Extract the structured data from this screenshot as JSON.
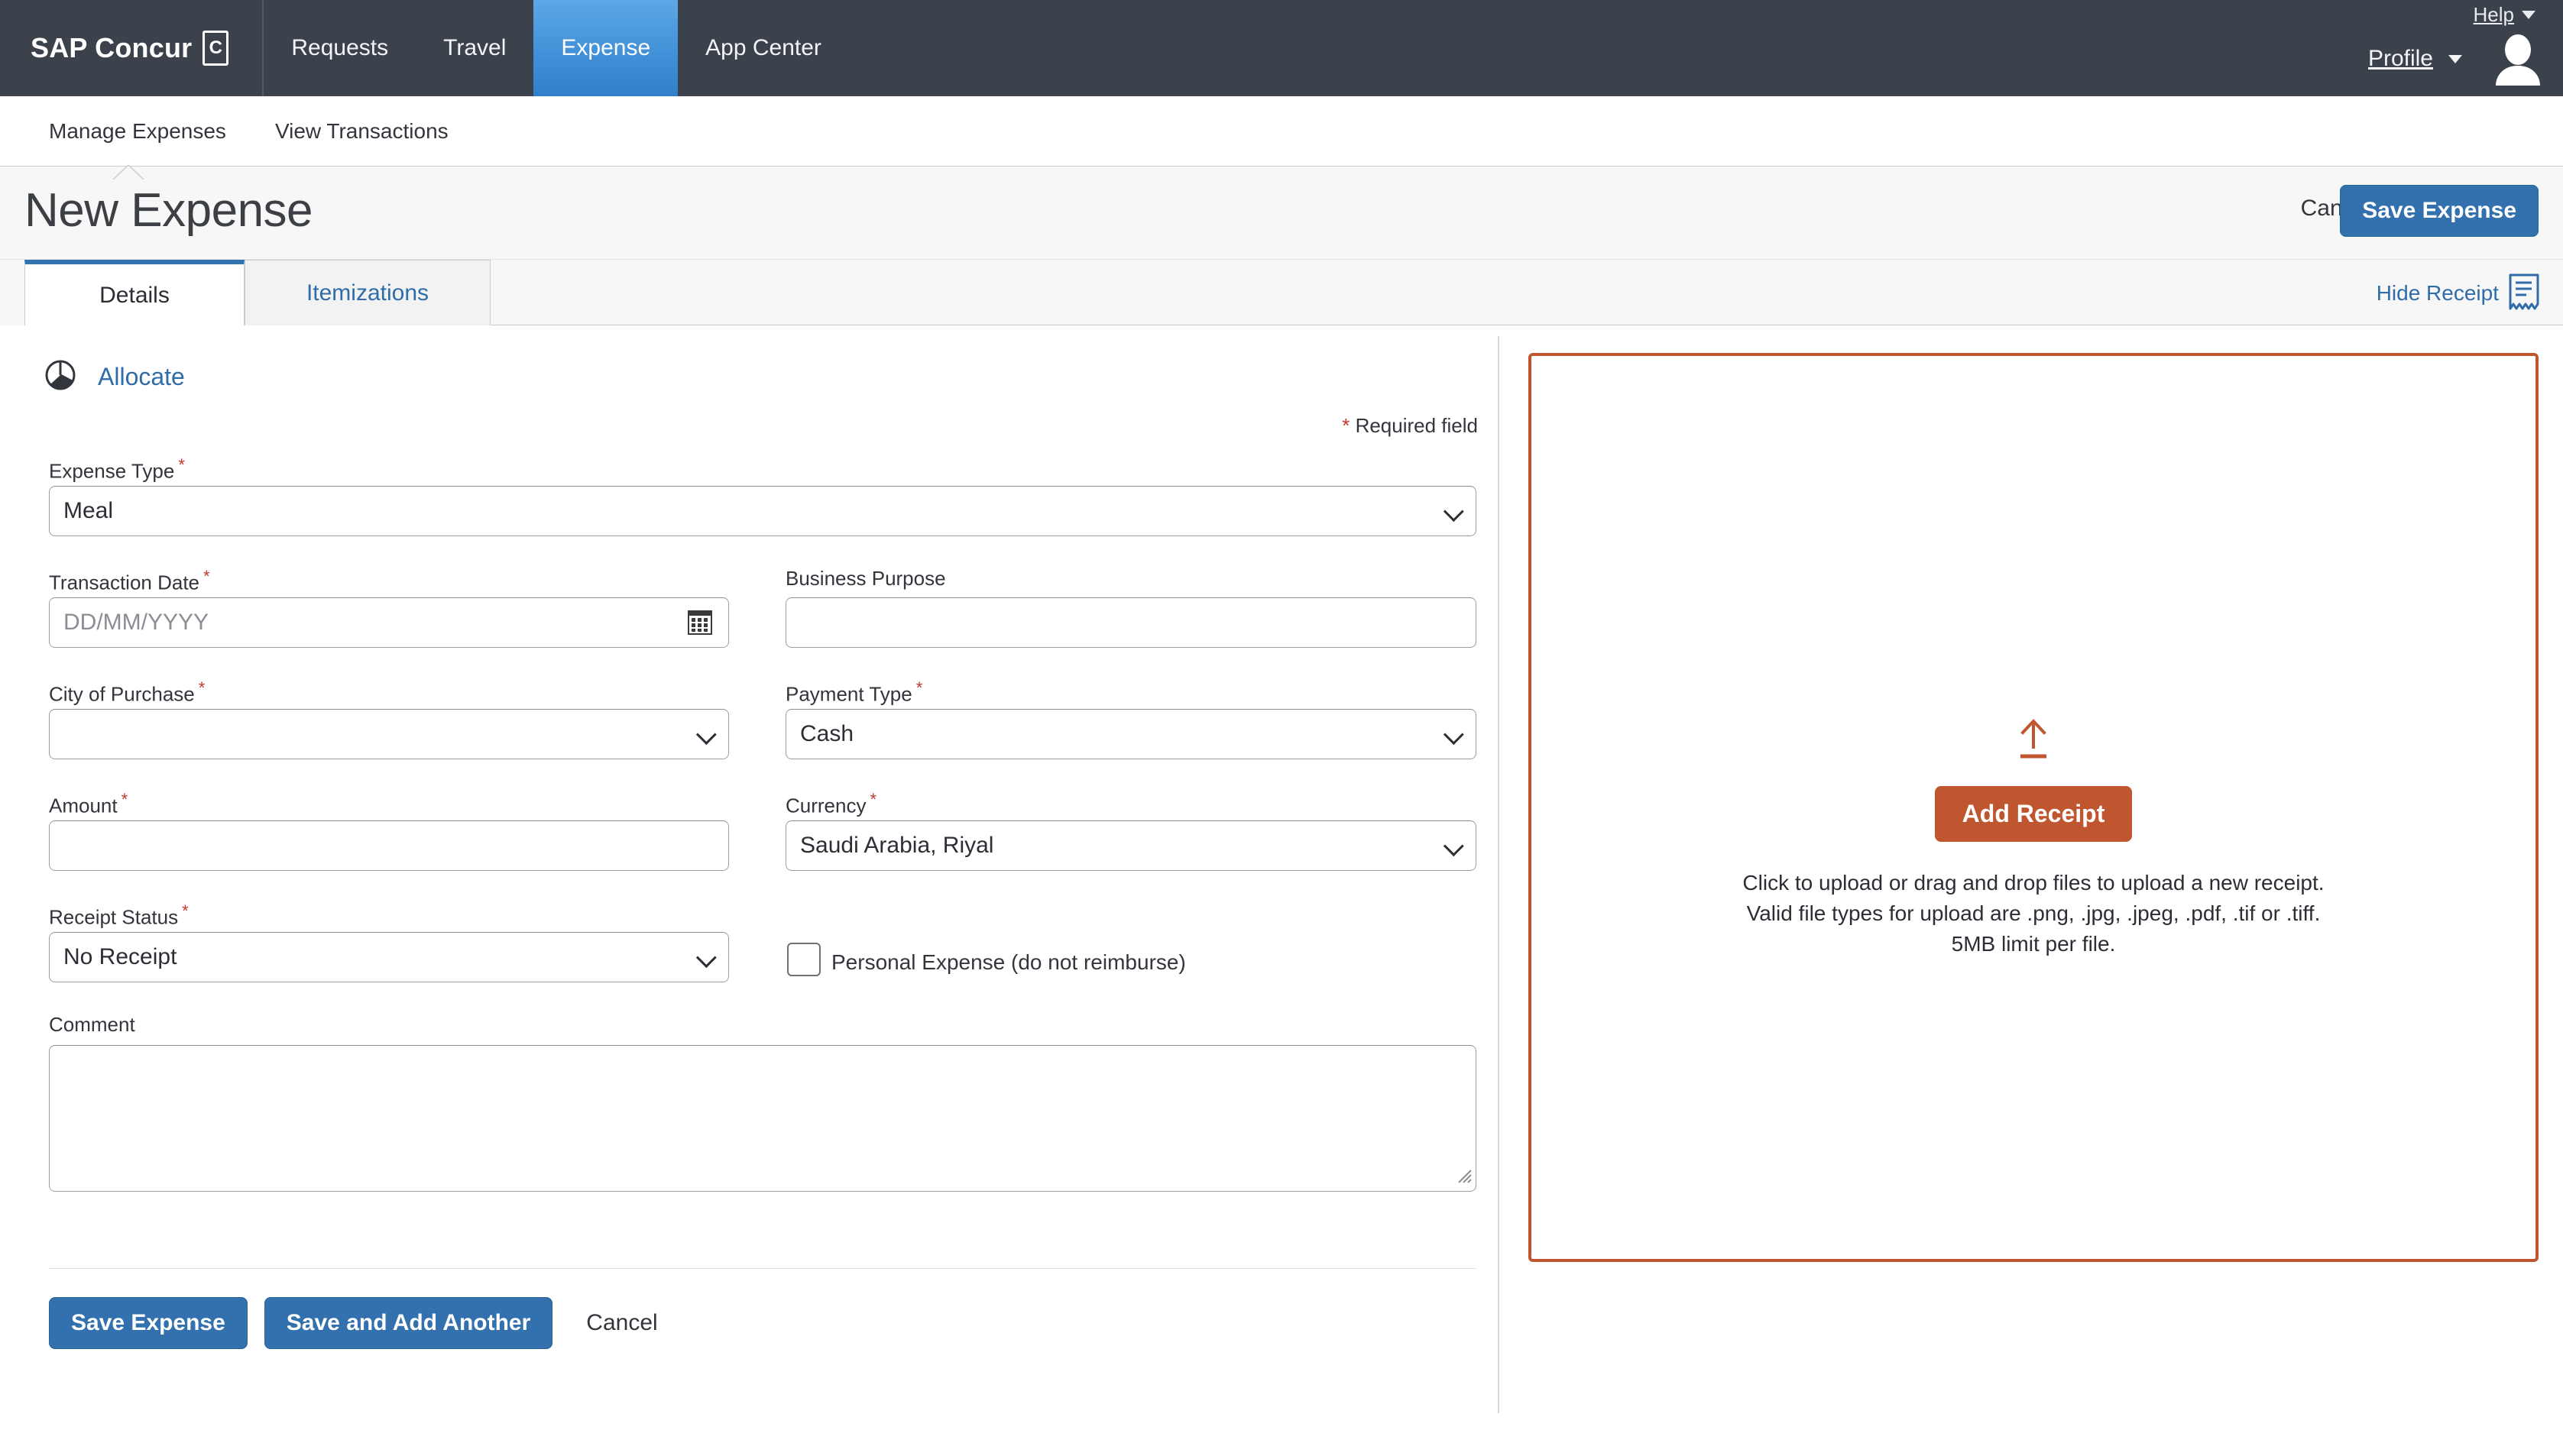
{
  "topnav": {
    "brand": "SAP Concur",
    "brand_mark": "C",
    "items": [
      {
        "label": "Requests",
        "active": false
      },
      {
        "label": "Travel",
        "active": false
      },
      {
        "label": "Expense",
        "active": true
      },
      {
        "label": "App Center",
        "active": false
      }
    ],
    "help_label": "Help",
    "profile_label": "Profile"
  },
  "subnav": {
    "items": [
      {
        "label": "Manage Expenses",
        "active": true
      },
      {
        "label": "View Transactions",
        "active": false
      }
    ]
  },
  "pagehead": {
    "title": "New Expense",
    "cancel_label": "Cancel",
    "save_label": "Save Expense"
  },
  "tabs": {
    "details_label": "Details",
    "itemizations_label": "Itemizations",
    "hide_receipt_label": "Hide Receipt"
  },
  "form": {
    "allocate_label": "Allocate",
    "required_note": "Required field",
    "required_star": "*",
    "expense_type": {
      "label": "Expense Type",
      "value": "Meal",
      "required": true
    },
    "transaction_date": {
      "label": "Transaction Date",
      "value": "",
      "placeholder": "DD/MM/YYYY",
      "required": true
    },
    "business_purpose": {
      "label": "Business Purpose",
      "value": "",
      "required": false
    },
    "city_of_purchase": {
      "label": "City of Purchase",
      "value": "",
      "required": true
    },
    "payment_type": {
      "label": "Payment Type",
      "value": "Cash",
      "required": true
    },
    "amount": {
      "label": "Amount",
      "value": "",
      "required": true
    },
    "currency": {
      "label": "Currency",
      "value": "Saudi Arabia, Riyal",
      "required": true
    },
    "receipt_status": {
      "label": "Receipt Status",
      "value": "No Receipt",
      "required": true
    },
    "personal_expense": {
      "label": "Personal Expense (do not reimburse)",
      "checked": false
    },
    "comment": {
      "label": "Comment",
      "value": ""
    },
    "save_label": "Save Expense",
    "save_add_label": "Save and Add Another",
    "cancel_label": "Cancel"
  },
  "receipt_panel": {
    "add_receipt_label": "Add Receipt",
    "line1": "Click to upload or drag and drop files to upload a new receipt.",
    "line2": "Valid file types for upload are .png, .jpg, .jpeg, .pdf, .tif or .tiff.",
    "line3": "5MB limit per file."
  },
  "colors": {
    "nav_bg": "#3b424c",
    "accent_blue": "#3271ad",
    "link_blue": "#2f6ca8",
    "accent_orange": "#c0562f",
    "required_red": "#c0392b"
  }
}
